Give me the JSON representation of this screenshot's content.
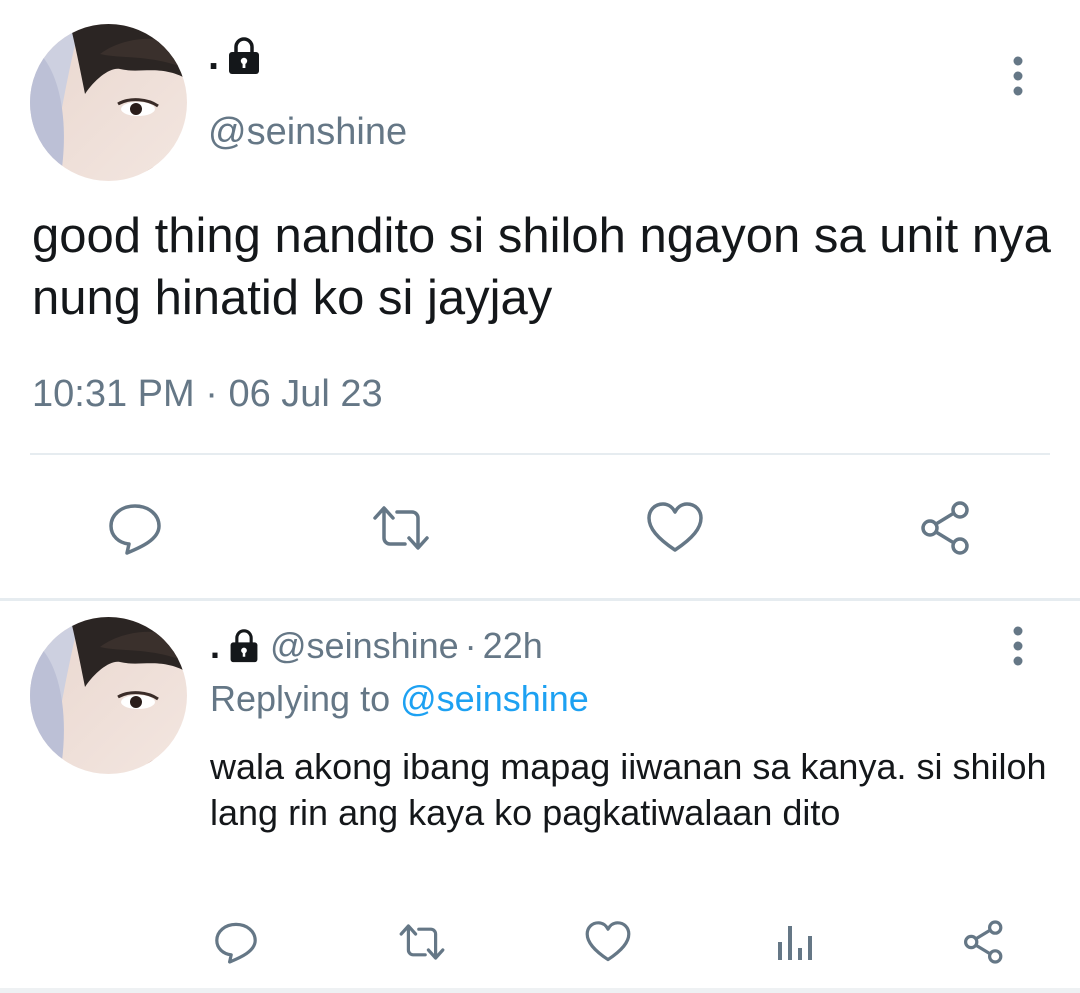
{
  "main_tweet": {
    "display_name": ".",
    "handle": "@seinshine",
    "text": "good thing nandito si shiloh ngayon sa unit nya nung hinatid ko si jayjay",
    "time": "10:31 PM",
    "separator": "·",
    "date": "06 Jul 23",
    "avatar_icon": "avatar-photo",
    "lock_icon": "lock-icon",
    "actions": [
      "reply-icon",
      "retweet-icon",
      "like-icon",
      "share-icon"
    ]
  },
  "reply_tweet": {
    "display_name": ".",
    "handle": "@seinshine",
    "separator": "·",
    "time": "22h",
    "replying_prefix": "Replying to",
    "replying_handle": "@seinshine",
    "text": "wala akong ibang mapag iiwanan sa kanya. si shiloh lang rin ang kaya ko pagkatiwalaan dito",
    "actions": [
      "reply-icon",
      "retweet-icon",
      "like-icon",
      "analytics-icon",
      "share-icon"
    ]
  },
  "colors": {
    "text_primary": "#14171a",
    "text_secondary": "#657786",
    "link": "#1da1f2",
    "divider": "#e6ecf0",
    "icon": "#657786"
  }
}
